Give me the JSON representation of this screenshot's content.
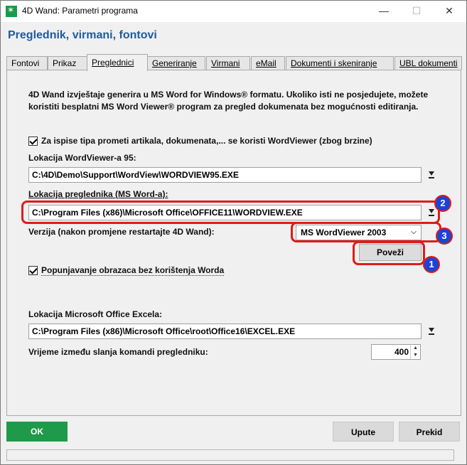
{
  "window": {
    "title": "4D Wand: Parametri programa",
    "controls": {
      "minimize": "—",
      "maximize": "☐",
      "close": "✕"
    }
  },
  "page_title": "Preglednik, virmani, fontovi",
  "tabs": [
    {
      "label": "Fontovi",
      "active": false
    },
    {
      "label": "Prikaz",
      "active": false
    },
    {
      "label": "Preglednici",
      "active": true
    },
    {
      "label": "Generiranje",
      "active": false
    },
    {
      "label": "Virmani",
      "active": false
    },
    {
      "label": "eMail",
      "active": false
    },
    {
      "label": "Dokumenti i skeniranje",
      "active": false
    },
    {
      "label": "UBL dokumenti",
      "active": false
    }
  ],
  "description": "4D Wand izvještaje generira u MS Word for Windows® formatu. Ukoliko isti ne posjedujete, možete koristiti besplatni MS Word Viewer® program za pregled dokumenata bez mogućnosti editiranja.",
  "wordviewer_checkbox": {
    "label": "Za ispise tipa prometi artikala, dokumenata,... se koristi WordViewer (zbog brzine)",
    "checked": true
  },
  "wordviewer95": {
    "label": "Lokacija WordViewer-a 95:",
    "value": "C:\\4D\\Demo\\Support\\WordView\\WORDVIEW95.EXE"
  },
  "msword": {
    "label": "Lokacija preglednika (MS Word-a):",
    "value": "C:\\Program Files (x86)\\Microsoft Office\\OFFICE11\\WORDVIEW.EXE"
  },
  "version": {
    "label": "Verzija (nakon promjene restartajte 4D Wand):",
    "selected": "MS WordViewer 2003"
  },
  "connect_button": "Poveži",
  "forms_checkbox": {
    "label": "Popunjavanje obrazaca bez korištenja Worda",
    "checked": true
  },
  "excel": {
    "label": "Lokacija Microsoft Office Excela:",
    "value": "C:\\Program Files (x86)\\Microsoft Office\\root\\Office16\\EXCEL.EXE"
  },
  "delay": {
    "label": "Vrijeme između slanja komandi pregledniku:",
    "value": "400"
  },
  "annotations": [
    "1",
    "2",
    "3"
  ],
  "footer": {
    "ok": "OK",
    "help": "Upute",
    "cancel": "Prekid"
  },
  "colors": {
    "accent": "#1d5b9e",
    "ok": "#1f9a4a",
    "annotation": "#e01b1b",
    "badge": "#1a44d6"
  }
}
